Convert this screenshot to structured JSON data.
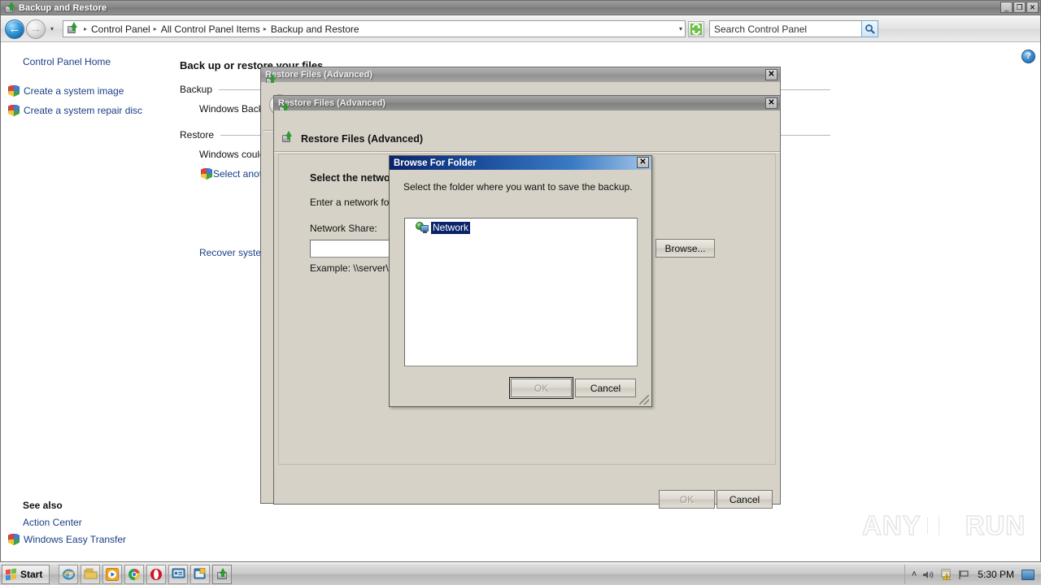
{
  "window": {
    "title": "Backup and Restore",
    "title_icon": "backup-restore-icon",
    "minimize_label": "_",
    "maximize_label": "❐",
    "close_label": "✕"
  },
  "navbar": {
    "back_label": "←",
    "forward_label": "→",
    "history_label": "▾",
    "breadcrumb_icon": "backup-restore-icon",
    "breadcrumbs": [
      "Control Panel",
      "All Control Panel Items",
      "Backup and Restore"
    ],
    "separator": "▸",
    "address_dropdown": "▾",
    "refresh_icon": "refresh-icon",
    "search_placeholder": "Search Control Panel",
    "search_icon": "search-icon",
    "help_icon": "help-icon",
    "help_label": "?"
  },
  "sidebar": {
    "home_label": "Control Panel Home",
    "links": [
      {
        "label": "Create a system image",
        "icon": "shield-icon"
      },
      {
        "label": "Create a system repair disc",
        "icon": "shield-icon"
      }
    ],
    "see_also_title": "See also",
    "see_also": [
      {
        "label": "Action Center",
        "icon": ""
      },
      {
        "label": "Windows Easy Transfer",
        "icon": "shield-icon"
      }
    ]
  },
  "main": {
    "heading": "Back up or restore your files",
    "backup_section": "Backup",
    "backup_text": "Windows Backup",
    "restore_section": "Restore",
    "restore_text": "Windows could",
    "select_another_link": "Select anoth",
    "recover_link": "Recover systen"
  },
  "dialog_back": {
    "titlebar_text": "Restore Files (Advanced)",
    "close_label": "✕",
    "back_arrow": "←",
    "header": "Restore Files (Advanced)",
    "icon": "restore-files-icon"
  },
  "dialog_front": {
    "titlebar_text": "Restore Files (Advanced)",
    "close_label": "✕",
    "header": "Restore Files (Advanced)",
    "icon": "restore-files-icon",
    "question": "Select the networ",
    "instruction": "Enter a network fol",
    "share_label": "Network Share:",
    "share_value": "",
    "example": "Example: \\\\server\\s",
    "browse_label": "Browse...",
    "ok_label": "OK",
    "cancel_label": "Cancel"
  },
  "browse_dialog": {
    "title": "Browse For Folder",
    "close_label": "✕",
    "prompt": "Select the folder where you want to save the backup.",
    "tree": [
      {
        "label": "Network",
        "icon": "network-icon",
        "selected": true
      }
    ],
    "ok_label": "OK",
    "cancel_label": "Cancel",
    "resize_grip": "resize-grip"
  },
  "watermark": {
    "left_text": "ANY",
    "right_text": "RUN"
  },
  "taskbar": {
    "start_label": "Start",
    "quick_launch": [
      {
        "name": "internet-explorer-icon"
      },
      {
        "name": "windows-explorer-icon"
      },
      {
        "name": "media-player-icon"
      },
      {
        "name": "chrome-icon"
      },
      {
        "name": "opera-icon"
      },
      {
        "name": "remote-desktop-icon"
      },
      {
        "name": "task-window-icon"
      },
      {
        "name": "backup-restore-icon"
      }
    ],
    "tray": {
      "overflow_label": "˄",
      "volume_icon": "speaker-icon",
      "action_center_icon": "flag-warning-icon",
      "network_icon": "network-flag-icon",
      "time": "5:30 PM",
      "show_desktop": "show-desktop-button"
    }
  },
  "colors": {
    "dialog_face": "#d6d2c8",
    "titlebar_active": "#0a246a",
    "selection": "#0a246a",
    "link": "#1a3e87"
  }
}
